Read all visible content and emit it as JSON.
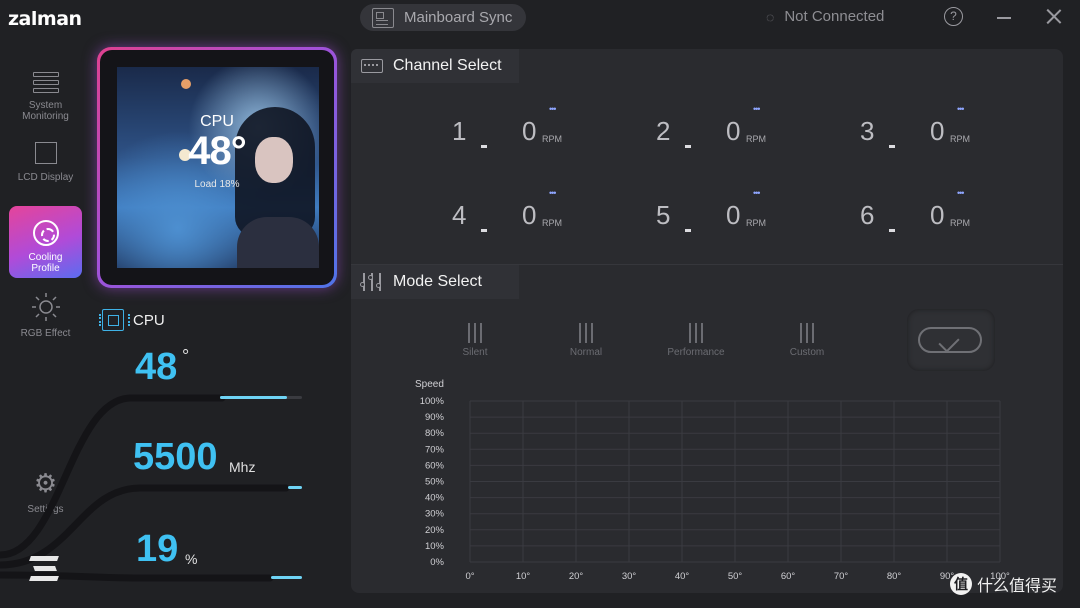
{
  "app": {
    "logo": "zalman",
    "sync_label": "Mainboard Sync",
    "connection_status": "Not Connected",
    "help_glyph": "?"
  },
  "sidebar": {
    "items": [
      {
        "label_line1": "System",
        "label_line2": "Monitoring",
        "icon": "system-monitoring-icon",
        "active": false
      },
      {
        "label_line1": "LCD Display",
        "label_line2": "",
        "icon": "lcd-display-icon",
        "active": false
      },
      {
        "label_line1": "Cooling",
        "label_line2": "Profile",
        "icon": "fan-icon",
        "active": true
      },
      {
        "label_line1": "RGB Effect",
        "label_line2": "",
        "icon": "sun-icon",
        "active": false
      },
      {
        "label_line1": "Settings",
        "label_line2": "",
        "icon": "gear-icon",
        "active": false
      }
    ]
  },
  "lcd": {
    "title": "CPU",
    "temp": "48°",
    "load": "Load 18%"
  },
  "stats": {
    "title": "CPU",
    "temp_value": "48",
    "temp_unit": "°",
    "clock_value": "5500",
    "clock_unit": "Mhz",
    "load_value": "19",
    "load_unit": "%",
    "temp_level": 0.48,
    "clock_level": 0.08,
    "load_level": 0.19
  },
  "channel_select": {
    "title": "Channel Select",
    "rpm_unit": "RPM",
    "channels": [
      {
        "number": "1",
        "rpm": "0"
      },
      {
        "number": "2",
        "rpm": "0"
      },
      {
        "number": "3",
        "rpm": "0"
      },
      {
        "number": "4",
        "rpm": "0"
      },
      {
        "number": "5",
        "rpm": "0"
      },
      {
        "number": "6",
        "rpm": "0"
      }
    ]
  },
  "mode_select": {
    "title": "Mode Select",
    "modes": [
      "Silent",
      "Normal",
      "Performance",
      "Custom"
    ],
    "toggle_on": true
  },
  "chart_data": {
    "type": "line",
    "ylabel": "Speed",
    "y_ticks": [
      "100%",
      "90%",
      "80%",
      "70%",
      "60%",
      "50%",
      "40%",
      "30%",
      "20%",
      "10%",
      "0%"
    ],
    "x_ticks": [
      "0°",
      "10°",
      "20°",
      "30°",
      "40°",
      "50°",
      "60°",
      "70°",
      "80°",
      "90°",
      "100°"
    ],
    "xlim": [
      0,
      100
    ],
    "ylim": [
      0,
      100
    ],
    "grid": true,
    "series": []
  },
  "watermark": {
    "badge": "值",
    "text": "什么值得买"
  },
  "colors": {
    "accent": "#3fc1f2",
    "active_gradient_start": "#e5449a",
    "active_gradient_end": "#5b6cf0",
    "channel_dots": "#8fa6ff"
  }
}
